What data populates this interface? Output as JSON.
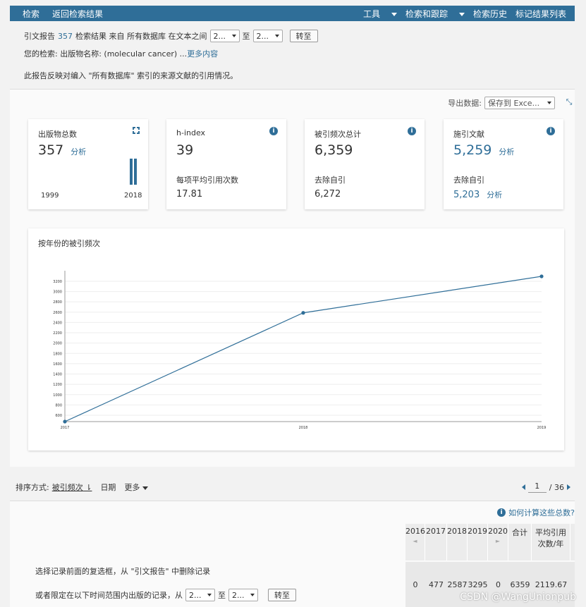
{
  "topbar": {
    "search": "检索",
    "back": "返回检索结果",
    "tools": "工具",
    "search_track": "检索和跟踪",
    "history": "检索历史",
    "marked": "标记结果列表"
  },
  "header": {
    "prefix": "引文报告",
    "count": "357",
    "mid": "检索结果 来自 所有数据库  在文本之间",
    "from_value": "2...",
    "to_label": "至",
    "to_value": "2...",
    "go": "转至",
    "query_label": "您的检索: 出版物名称: (molecular cancer) ...",
    "more": "更多内容",
    "note": "此报告反映对编入 \"所有数据库\" 索引的来源文献的引用情况。"
  },
  "export": {
    "label": "导出数据:",
    "value": "保存到 Exce..."
  },
  "cards": {
    "pubs": {
      "title": "出版物总数",
      "value": "357",
      "analyze": "分析",
      "year_start": "1999",
      "year_end": "2018"
    },
    "hindex": {
      "title": "h-index",
      "value": "39",
      "sub": "每项平均引用次数",
      "subval": "17.81"
    },
    "cited": {
      "title": "被引频次总计",
      "value": "6,359",
      "sub": "去除自引",
      "subval": "6,272"
    },
    "citing": {
      "title": "施引文献",
      "value": "5,259",
      "analyze": "分析",
      "sub": "去除自引",
      "subval": "5,203",
      "sub_analyze": "分析"
    }
  },
  "chart_data": {
    "type": "line",
    "title": "按年份的被引频次",
    "x": [
      "2017",
      "2018",
      "2019"
    ],
    "values": [
      477,
      2587,
      3295
    ],
    "yticks": [
      600,
      800,
      1000,
      1200,
      1400,
      1600,
      1800,
      2000,
      2200,
      2400,
      2600,
      2800,
      3000,
      3200
    ],
    "ylim": [
      477,
      3295
    ],
    "color": "#2f6e98",
    "grid": true
  },
  "sort": {
    "label": "排序方式:",
    "cited": "被引频次",
    "date": "日期",
    "more": "更多",
    "page": "1",
    "total": "/ 36"
  },
  "bottom": {
    "how": "如何计算这些总数?",
    "note1": "选择记录前面的复选框，从 \"引文报告\" 中删除记录",
    "note2_prefix": "或者限定在以下时间范围内出版的记录，从",
    "from_value": "2...",
    "to_label": "至",
    "to_value": "2...",
    "go": "转至"
  },
  "table": {
    "headers": [
      "2016",
      "2017",
      "2018",
      "2019",
      "2020",
      "合计",
      "平均引用次数/年"
    ],
    "values": [
      "0",
      "477",
      "2587",
      "3295",
      "0",
      "6359",
      "2119.67"
    ]
  },
  "watermark": "CSDN @WangUnionpub"
}
